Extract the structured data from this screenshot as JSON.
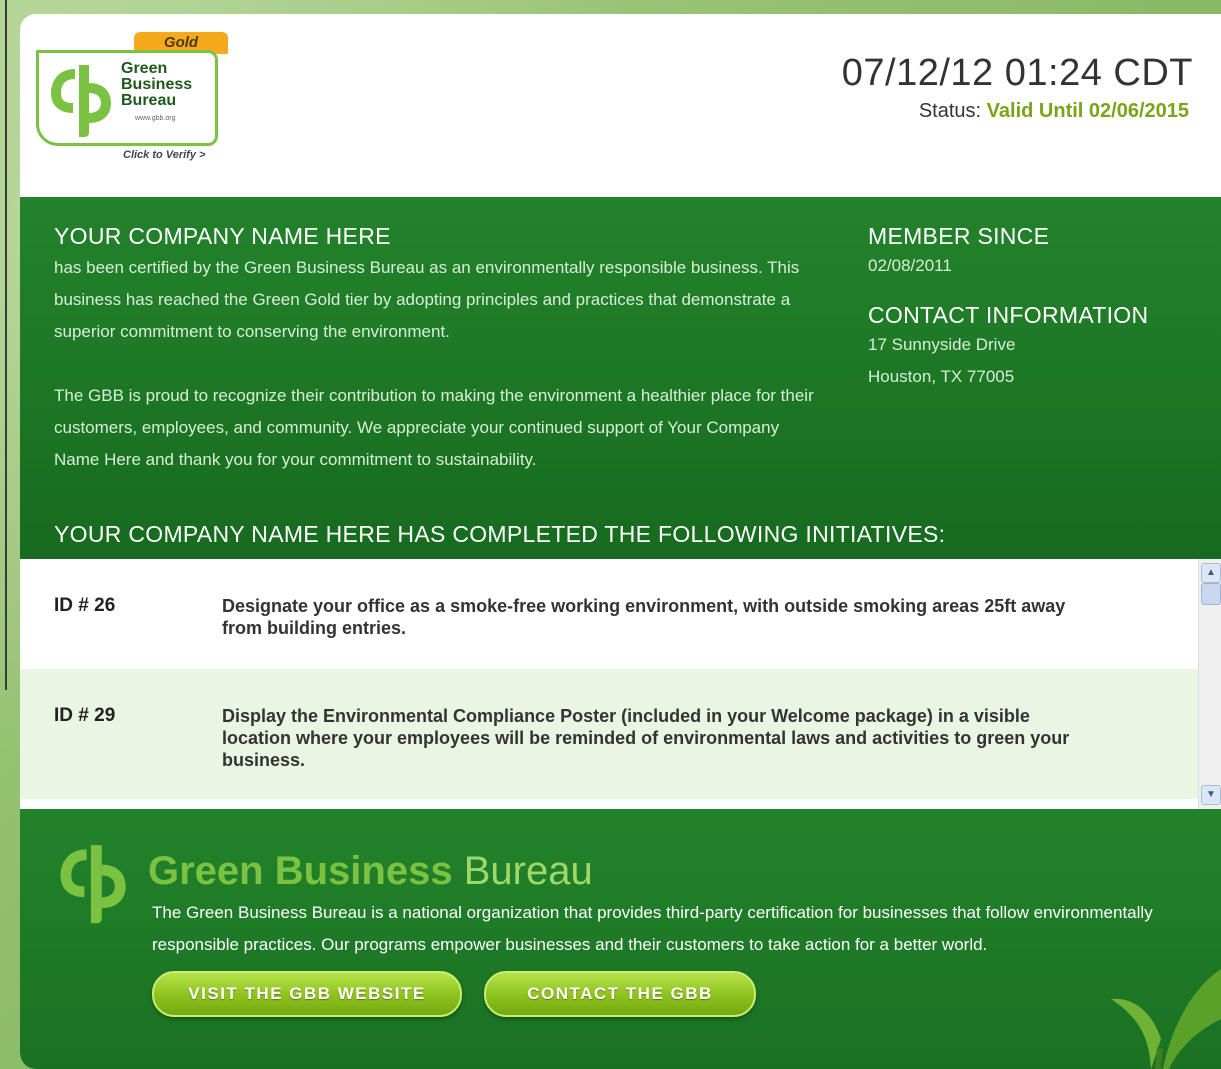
{
  "header": {
    "logo": {
      "tier": "Gold",
      "line1": "Green",
      "line2": "Business",
      "line3": "Bureau",
      "url": "www.gbb.org",
      "verify": "Click to Verify >"
    },
    "datetime": "07/12/12 01:24 CDT",
    "status_label": "Status:",
    "status_value": "Valid Until 02/06/2015"
  },
  "company": {
    "name": "YOUR COMPANY NAME HERE",
    "paragraph1": "has been certified by the Green Business Bureau as an environmentally responsible business. This business has reached the Green Gold tier by adopting principles and practices that demonstrate a superior commitment to conserving the environment.",
    "paragraph2": "The GBB is proud to recognize their contribution to making the environment a healthier place for their customers, employees, and community. We appreciate your continued support of Your Company Name Here and thank you for your commitment to sustainability."
  },
  "member": {
    "heading": "MEMBER SINCE",
    "date": "02/08/2011"
  },
  "contact": {
    "heading": "CONTACT INFORMATION",
    "address1": "17 Sunnyside Drive",
    "address2": "Houston, TX 77005"
  },
  "initiatives": {
    "title": "YOUR COMPANY NAME HERE HAS COMPLETED THE FOLLOWING INITIATIVES:",
    "items": [
      {
        "id": "ID # 26",
        "text": "Designate your office as a smoke-free working environment, with outside smoking areas 25ft away from building entries."
      },
      {
        "id": "ID # 29",
        "text": "Display the Environmental Compliance Poster (included in your Welcome package) in a visible location where your employees will be reminded of environmental laws and activities to green your business."
      }
    ]
  },
  "footer": {
    "brand_bold": "Green Business",
    "brand_light": "Bureau",
    "description": "The Green Business Bureau is a national organization that provides third-party certification for businesses that follow environmentally responsible practices. Our programs empower businesses and their customers to take action for a better world.",
    "visit_button": "VISIT THE GBB WEBSITE",
    "contact_button": "CONTACT THE GBB"
  },
  "colors": {
    "brand_green": "#1e7a26",
    "accent_lime": "#7cc242",
    "gold": "#f5a91c",
    "status_valid": "#7aa318"
  }
}
